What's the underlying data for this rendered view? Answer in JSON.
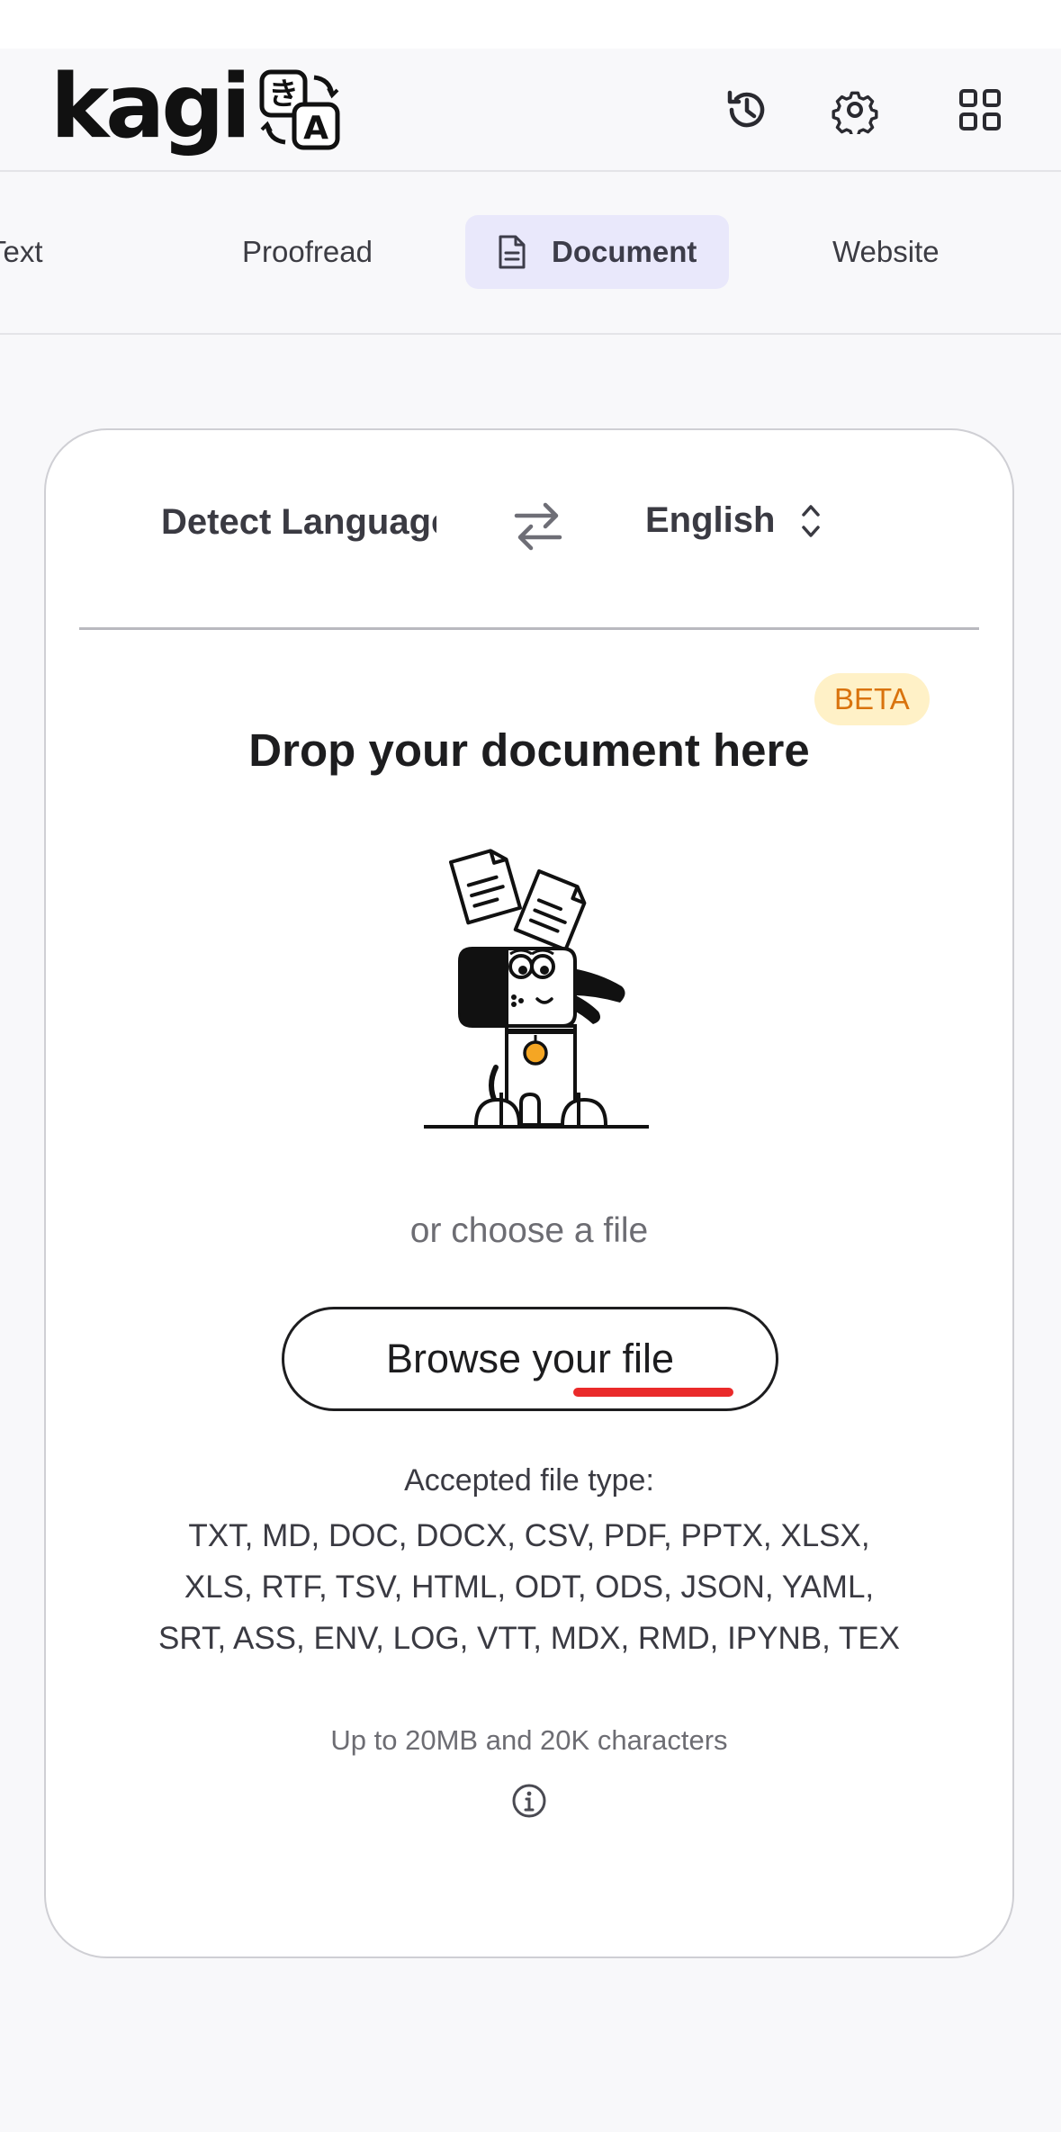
{
  "brand": {
    "logo_text": "kagi",
    "logo_mark_icon": "translate-glyph-icon"
  },
  "header": {
    "icons": [
      "history-icon",
      "gear-icon",
      "apps-grid-icon"
    ]
  },
  "tabs": {
    "items": [
      {
        "label": "Text"
      },
      {
        "label": "Proofread"
      },
      {
        "label": "Document",
        "active": true,
        "icon": "document-icon"
      },
      {
        "label": "Website"
      }
    ],
    "active_index": 2
  },
  "translator": {
    "source_language": "Detect Language",
    "target_language": "English",
    "swap_icon": "swap-arrows-icon",
    "target_selector_icon": "chevron-up-down-icon"
  },
  "dropzone": {
    "badge": "BETA",
    "title": "Drop your document here",
    "illustration": "dog-with-documents",
    "or_text": "or choose a file",
    "browse_label": "Browse your file",
    "accepted_title": "Accepted file type:",
    "accepted_types": "TXT, MD, DOC, DOCX, CSV, PDF, PPTX, XLSX, XLS, RTF, TSV, HTML, ODT, ODS, JSON, YAML, SRT, ASS, ENV, LOG, VTT, MDX, RMD, IPYNB, TEX",
    "limit_note": "Up to 20MB and 20K characters",
    "info_icon": "info-icon"
  },
  "colors": {
    "active_tab_bg": "#e9e8fb",
    "beta_bg": "#fff1c7",
    "beta_text": "#d9730d",
    "annotation_underline": "#ea2a2a",
    "dog_medal": "#f5a623"
  }
}
